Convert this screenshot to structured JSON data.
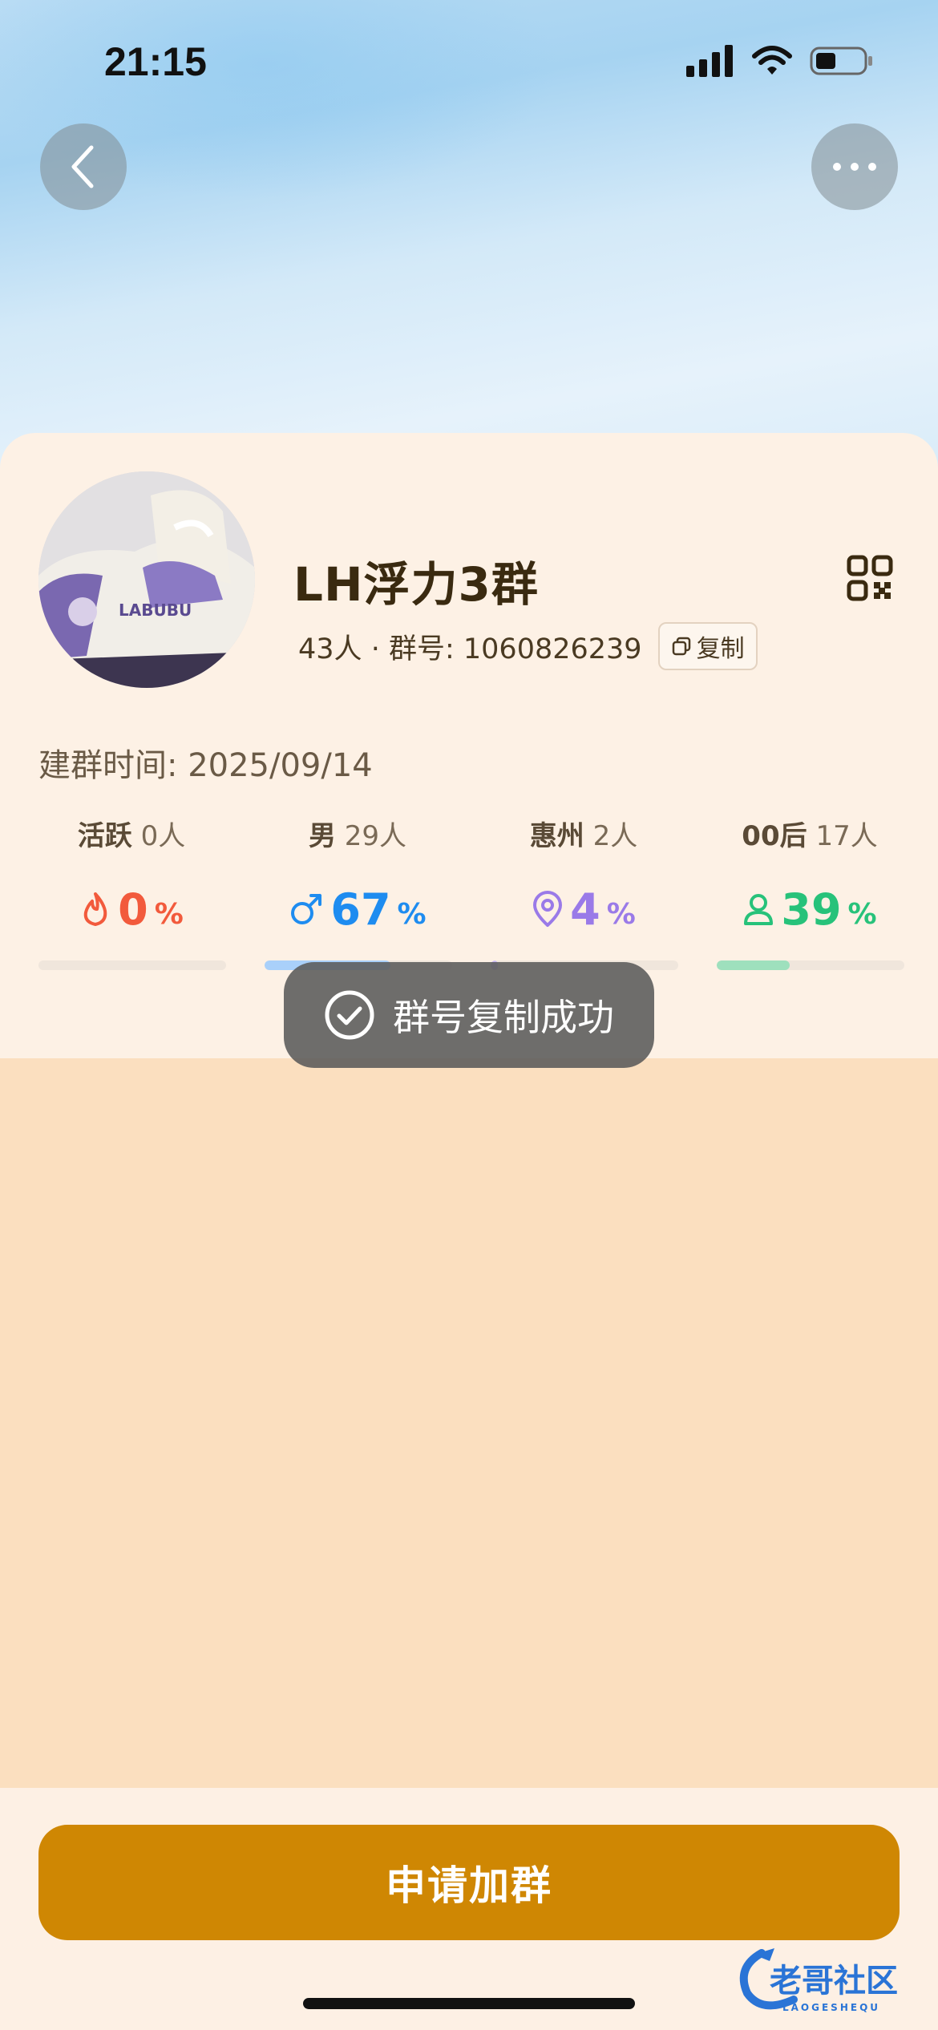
{
  "status_bar": {
    "time": "21:15"
  },
  "nav": {
    "back_icon": "chevron-left-icon",
    "more_icon": "more-horizontal-icon"
  },
  "group": {
    "name": "LH浮力3群",
    "member_count": "43人",
    "separator": "·",
    "id_label": "群号: 1060826239",
    "copy_label": "复制",
    "created_label": "建群时间: 2025/09/14"
  },
  "stats": [
    {
      "label": "活跃",
      "count": "0人",
      "value": "0",
      "unit": "%",
      "icon": "flame-icon",
      "color": "#f25a3c",
      "bar_fraction": 0.0
    },
    {
      "label": "男",
      "count": "29人",
      "value": "67",
      "unit": "%",
      "icon": "male-icon",
      "color": "#1e8cf0",
      "bar_fraction": 0.67
    },
    {
      "label": "惠州",
      "count": "2人",
      "value": "4",
      "unit": "%",
      "icon": "location-pin-icon",
      "color": "#9a7ae8",
      "bar_fraction": 0.04
    },
    {
      "label": "00后",
      "count": "17人",
      "value": "39",
      "unit": "%",
      "icon": "person-icon",
      "color": "#27c27a",
      "bar_fraction": 0.39
    }
  ],
  "toast": {
    "text": "群号复制成功",
    "icon": "check-circle-icon"
  },
  "footer": {
    "join_label": "申请加群"
  },
  "watermark": {
    "text": "老哥社区",
    "subtext": "LAOGESHEQU"
  }
}
